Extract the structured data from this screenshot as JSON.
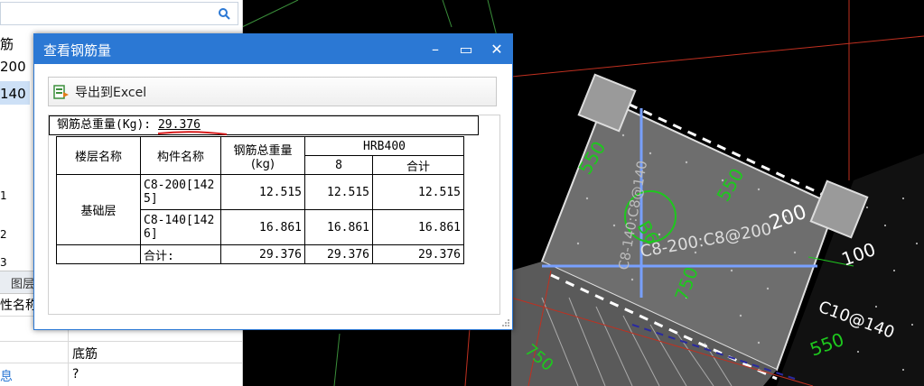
{
  "left_panel": {
    "rows": [
      "筋",
      "200",
      "140"
    ],
    "tabs": [
      "图层"
    ],
    "grid": [
      {
        "left": "性名称",
        "right": ""
      },
      {
        "left": "",
        "right": "底筋"
      },
      {
        "left": "息",
        "right": "?"
      }
    ],
    "row_numbers": [
      "1",
      "2",
      "3"
    ]
  },
  "dialog": {
    "title": "查看钢筋量",
    "minimize": "–",
    "maximize": "▭",
    "close": "✕",
    "export_label": "导出到Excel",
    "total_label": "钢筋总重量(Kg):",
    "total_value": "29.376",
    "headers": {
      "floor": "楼层名称",
      "component": "构件名称",
      "total_weight": "钢筋总重量(kg)",
      "grade": "HRB400",
      "diameter": "8",
      "sum": "合计"
    },
    "floor_name": "基础层",
    "rows": [
      {
        "component": "C8-200[1425]",
        "total": "12.515",
        "d8": "12.515",
        "sum": "12.515"
      },
      {
        "component": "C8-140[1426]",
        "total": "16.861",
        "d8": "16.861",
        "sum": "16.861"
      },
      {
        "component": "合计:",
        "total": "29.376",
        "d8": "29.376",
        "sum": "29.376"
      }
    ]
  },
  "cad": {
    "labels": [
      "550",
      "550",
      "200",
      "C8-200:C8@200",
      "C8-140:C8@140",
      "100",
      "C10@140",
      "550",
      "750",
      "B6"
    ]
  },
  "colors": {
    "title_bar": "#2b78d4",
    "cad_green": "#1ec81e",
    "cad_blue": "#78a0ff"
  }
}
